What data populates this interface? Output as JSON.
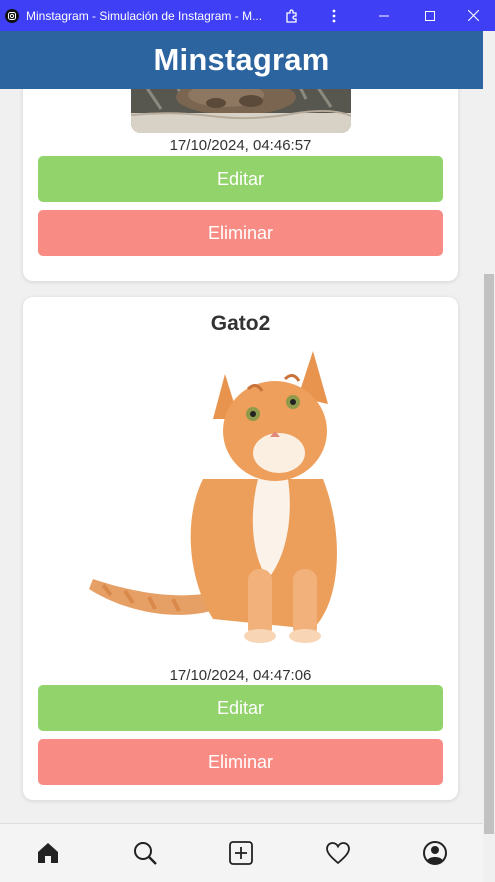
{
  "window": {
    "title": "Minstagram - Simulación de Instagram - M..."
  },
  "header": {
    "title": "Minstagram"
  },
  "posts": [
    {
      "title": "",
      "timestamp": "17/10/2024, 04:46:57",
      "edit_label": "Editar",
      "delete_label": "Eliminar"
    },
    {
      "title": "Gato2",
      "timestamp": "17/10/2024, 04:47:06",
      "edit_label": "Editar",
      "delete_label": "Eliminar"
    }
  ],
  "nav": {
    "items": [
      "home-icon",
      "search-icon",
      "add-icon",
      "heart-icon",
      "profile-icon"
    ]
  },
  "colors": {
    "titlebar": "#3f3ff5",
    "header": "#2c64a0",
    "edit": "#92d36b",
    "delete": "#f88c84"
  }
}
